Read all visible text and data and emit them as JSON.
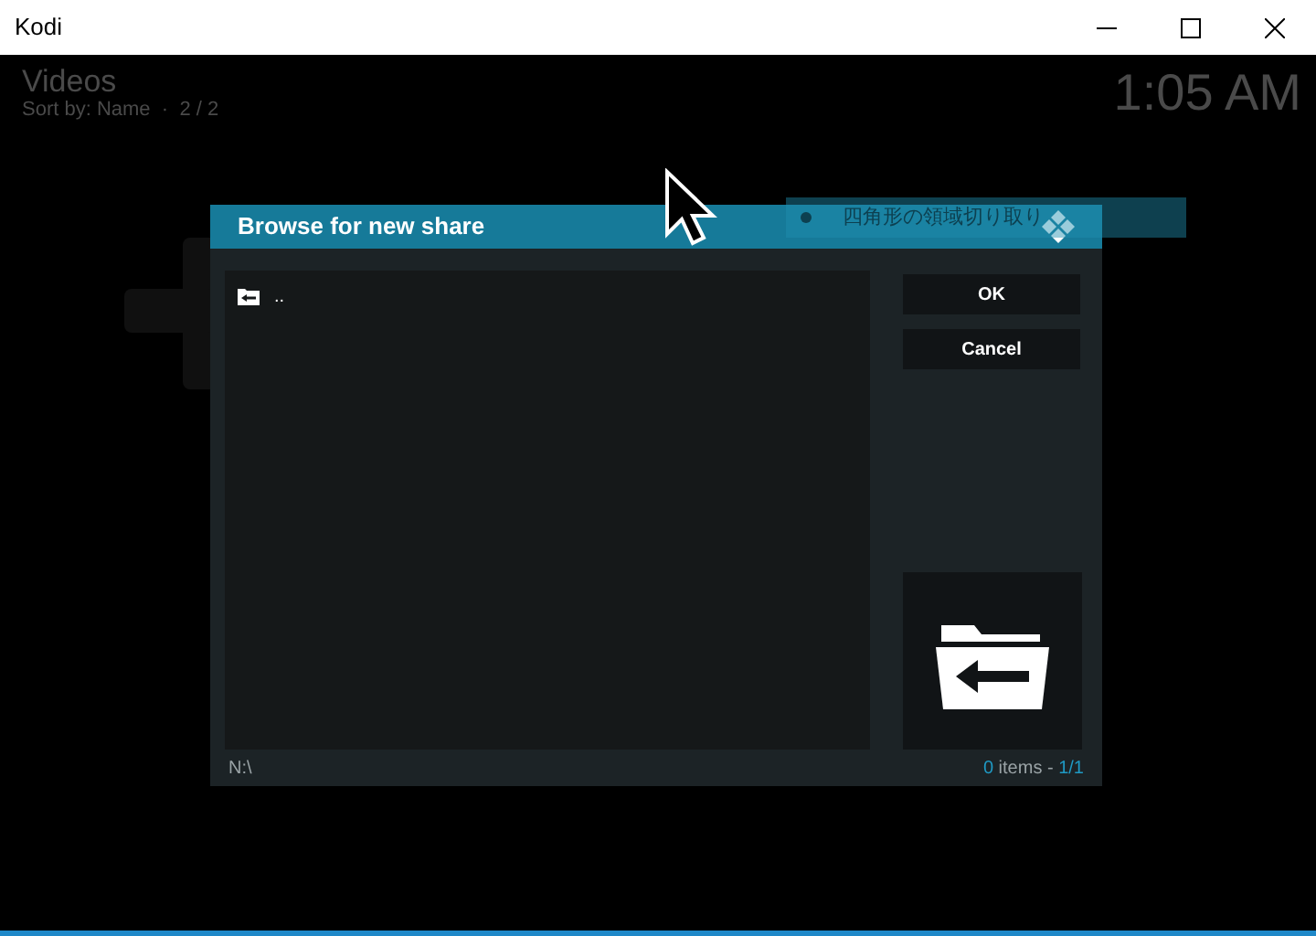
{
  "window": {
    "title": "Kodi"
  },
  "background": {
    "title": "Videos",
    "subtitle": "Sort by: Name  ·  2 / 2",
    "clock": "1:05 AM",
    "list_item": "四角形の領域切り取り"
  },
  "dialog": {
    "title": "Browse for new share",
    "items": [
      {
        "label": ".."
      }
    ],
    "buttons": [
      "OK",
      "Cancel"
    ],
    "path": "N:\\",
    "footer": {
      "count": "0",
      "label": " items - ",
      "page": "1/1"
    }
  }
}
